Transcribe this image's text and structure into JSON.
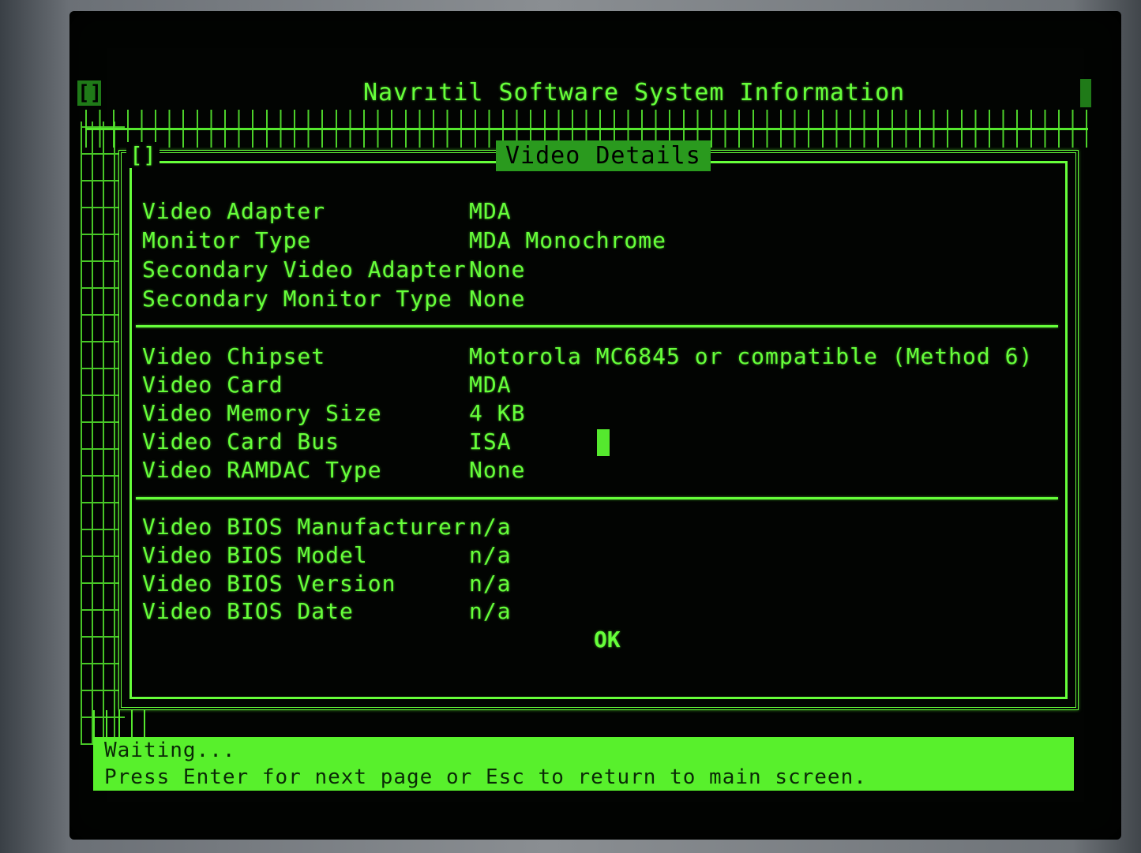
{
  "window": {
    "title": "Navrıtil Software System Information",
    "close_glyph": "[]"
  },
  "dialog": {
    "title": "Video Details",
    "close_glyph": "[]",
    "sections": [
      {
        "rows": [
          {
            "label": "Video Adapter",
            "value": "MDA"
          },
          {
            "label": "Monitor Type",
            "value": "MDA Monochrome"
          },
          {
            "label": "Secondary Video Adapter",
            "value": "None"
          },
          {
            "label": "Secondary Monitor Type",
            "value": "None"
          }
        ]
      },
      {
        "rows": [
          {
            "label": "Video Chipset",
            "value": "Motorola MC6845 or compatible (Method 6)"
          },
          {
            "label": "Video Card",
            "value": "MDA"
          },
          {
            "label": "Video Memory Size",
            "value": "4 KB"
          },
          {
            "label": "Video Card Bus",
            "value": "ISA"
          },
          {
            "label": "Video RAMDAC Type",
            "value": "None"
          }
        ]
      },
      {
        "rows": [
          {
            "label": "Video BIOS Manufacturer",
            "value": "n/a"
          },
          {
            "label": "Video BIOS Model",
            "value": "n/a"
          },
          {
            "label": "Video BIOS Version",
            "value": "n/a"
          },
          {
            "label": "Video BIOS Date",
            "value": "n/a"
          }
        ]
      }
    ],
    "ok_label": "OK"
  },
  "status": {
    "line1": "Waiting...",
    "line2": "Press Enter for next page or Esc to return to main screen."
  },
  "colors": {
    "phosphor": "#66ff3a",
    "background": "#020402",
    "status_bar": "#58f02c"
  }
}
